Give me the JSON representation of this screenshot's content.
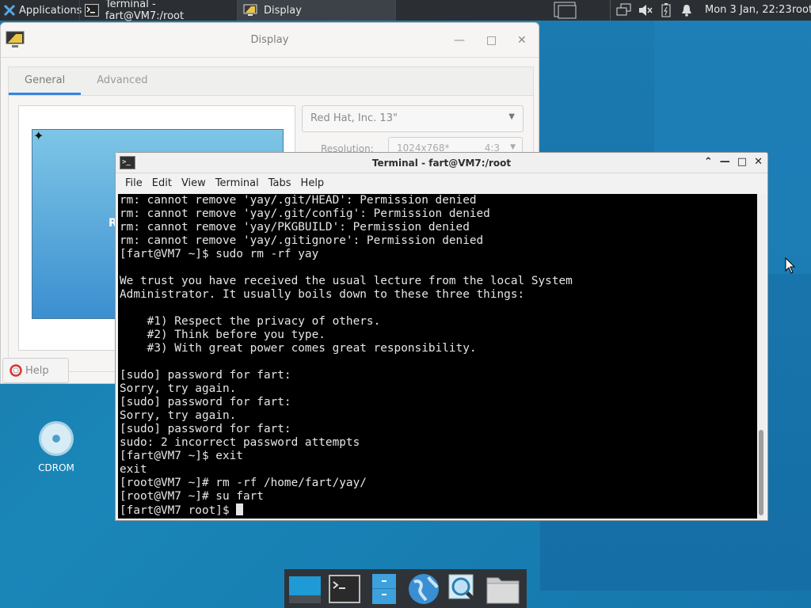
{
  "top_panel": {
    "applications_label": "Applications",
    "tasks": [
      {
        "label": "Terminal - fart@VM7:/root"
      },
      {
        "label": "Display"
      }
    ],
    "clock": "Mon 3 Jan, 22:23",
    "user": "root"
  },
  "display_window": {
    "title": "Display",
    "tabs": [
      {
        "label": "General"
      },
      {
        "label": "Advanced"
      }
    ],
    "monitor_dropdown": "Red Hat, Inc. 13\"",
    "resolution_label": "Resolution:",
    "resolution_value": "1024x768*",
    "aspect_ratio": "4:3",
    "monitor_partial_letter": "R",
    "help_label": "Help"
  },
  "terminal_window": {
    "title": "Terminal - fart@VM7:/root",
    "menu": [
      "File",
      "Edit",
      "View",
      "Terminal",
      "Tabs",
      "Help"
    ],
    "lines": [
      "rm: cannot remove 'yay/.git/HEAD': Permission denied",
      "rm: cannot remove 'yay/.git/config': Permission denied",
      "rm: cannot remove 'yay/PKGBUILD': Permission denied",
      "rm: cannot remove 'yay/.gitignore': Permission denied",
      "[fart@VM7 ~]$ sudo rm -rf yay",
      "",
      "We trust you have received the usual lecture from the local System",
      "Administrator. It usually boils down to these three things:",
      "",
      "    #1) Respect the privacy of others.",
      "    #2) Think before you type.",
      "    #3) With great power comes great responsibility.",
      "",
      "[sudo] password for fart:",
      "Sorry, try again.",
      "[sudo] password for fart:",
      "Sorry, try again.",
      "[sudo] password for fart:",
      "sudo: 2 incorrect password attempts",
      "[fart@VM7 ~]$ exit",
      "exit",
      "[root@VM7 ~]# rm -rf /home/fart/yay/",
      "[root@VM7 ~]# su fart",
      "[fart@VM7 root]$ "
    ]
  },
  "desktop": {
    "icons": [
      {
        "label": "CDROM"
      }
    ]
  },
  "colors": {
    "panel": "#2b2f33",
    "terminal_bg": "#000000",
    "desktop": "#1a86b8",
    "accent": "#3584e4"
  }
}
